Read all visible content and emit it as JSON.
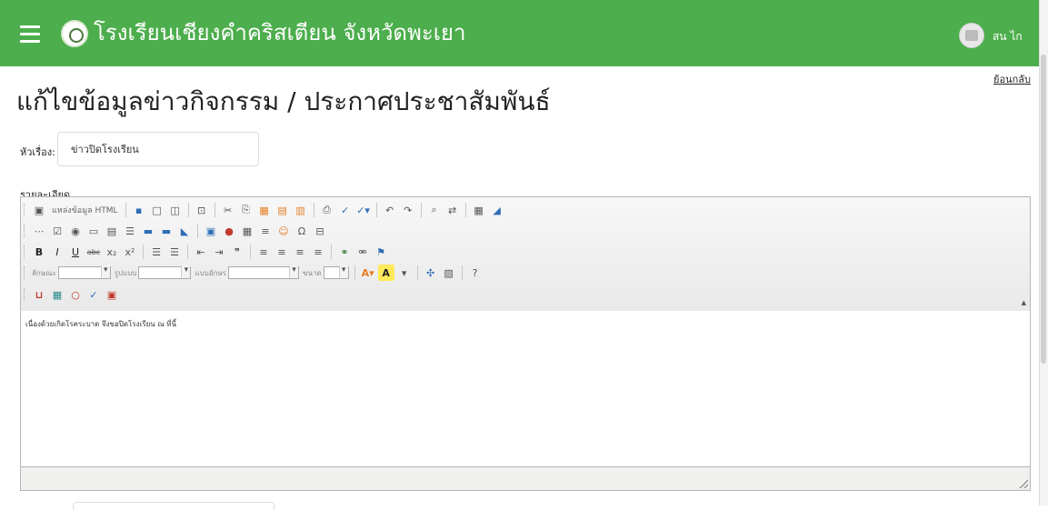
{
  "header": {
    "menu_icon": "hamburger-icon",
    "logo_icon": "school-logo-icon",
    "brand_title": "โรงเรียนเชียงคำคริสเตียน จังหวัดพะเยา",
    "avatar_icon": "user-avatar-icon",
    "username": "สน ไก",
    "bg_color": "#4cae4c"
  },
  "page": {
    "back_link": "ย้อนกลับ",
    "title": "แก้ไขข้อมูลข่าวกิจกรรม / ประกาศประชาสัมพันธ์"
  },
  "form": {
    "subject_label": "หัวเรื่อง:",
    "subject_value": "ข่าวปิดโรงเรียน",
    "detail_label": "รายละเอียด"
  },
  "editor": {
    "source_label": "แหล่งข้อมูล HTML",
    "format_label": "ลักษณะ",
    "style_label": "รูปแบบ",
    "font_label": "แบบอักษร",
    "size_label": "ขนาด",
    "content_text": "เนื่องด้วยเกิดโรคระบาด จึงขอปิดโรงเรียน ณ ที่นี้"
  }
}
